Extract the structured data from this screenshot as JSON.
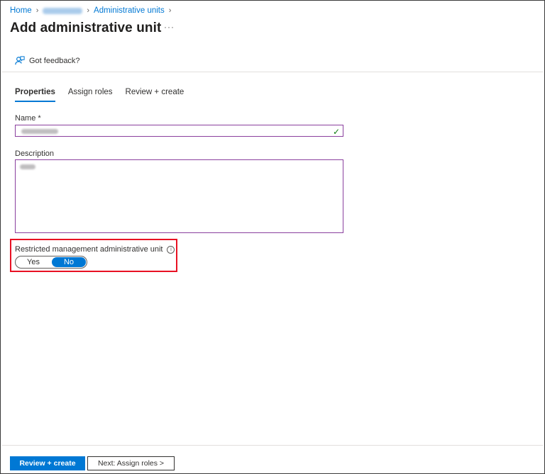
{
  "breadcrumb": {
    "home": "Home",
    "current": "Administrative units"
  },
  "page": {
    "title": "Add administrative unit",
    "more_label": "···"
  },
  "feedback": {
    "label": "Got feedback?"
  },
  "tabs": [
    {
      "label": "Properties",
      "active": true
    },
    {
      "label": "Assign roles",
      "active": false
    },
    {
      "label": "Review + create",
      "active": false
    }
  ],
  "form": {
    "name_label": "Name *",
    "description_label": "Description",
    "restricted_label": "Restricted management administrative unit",
    "toggle": {
      "yes": "Yes",
      "no": "No",
      "selected": "No"
    }
  },
  "footer": {
    "review_create": "Review + create",
    "next": "Next: Assign roles >"
  },
  "colors": {
    "accent": "#0078d4",
    "input_border": "#8a3f9e",
    "highlight": "#e81123",
    "valid": "#107c10"
  },
  "icons": {
    "feedback": "feedback-person-icon",
    "info": "info-icon",
    "check": "checkmark-icon",
    "chevron": "chevron-right-icon"
  }
}
